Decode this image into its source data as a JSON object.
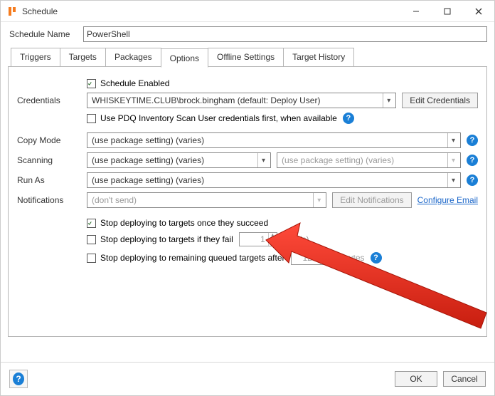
{
  "window": {
    "title": "Schedule",
    "minimize_tooltip": "Minimize",
    "maximize_tooltip": "Maximize",
    "close_tooltip": "Close"
  },
  "schedule_name": {
    "label": "Schedule Name",
    "value": "PowerShell"
  },
  "tabs": {
    "items": [
      {
        "label": "Triggers"
      },
      {
        "label": "Targets"
      },
      {
        "label": "Packages"
      },
      {
        "label": "Options"
      },
      {
        "label": "Offline Settings"
      },
      {
        "label": "Target History"
      }
    ],
    "active_index": 3
  },
  "options": {
    "schedule_enabled": {
      "label": "Schedule Enabled",
      "checked": true
    },
    "credentials": {
      "label": "Credentials",
      "value": "WHISKEYTIME.CLUB\\brock.bingham (default: Deploy User)",
      "edit_button": "Edit Credentials",
      "use_inventory_user_label": "Use PDQ Inventory Scan User credentials first, when available",
      "use_inventory_user_checked": false
    },
    "copy_mode": {
      "label": "Copy Mode",
      "value": "(use package setting) (varies)"
    },
    "scanning": {
      "label": "Scanning",
      "value": "(use package setting) (varies)",
      "secondary_placeholder": "(use package setting) (varies)"
    },
    "run_as": {
      "label": "Run As",
      "value": "(use package setting) (varies)"
    },
    "notifications": {
      "label": "Notifications",
      "placeholder": "(don't send)",
      "edit_button": "Edit Notifications",
      "configure_link": "Configure Email"
    },
    "stop_on_success": {
      "label": "Stop deploying to targets once they succeed",
      "checked": true
    },
    "stop_on_fail": {
      "label_before": "Stop deploying to targets if they fail",
      "checked": false,
      "times_value": "1",
      "label_after": "time(s)"
    },
    "stop_after": {
      "label_before": "Stop deploying to remaining queued targets after",
      "checked": false,
      "minutes_value": "120",
      "label_after": "minutes"
    }
  },
  "footer": {
    "ok": "OK",
    "cancel": "Cancel"
  }
}
